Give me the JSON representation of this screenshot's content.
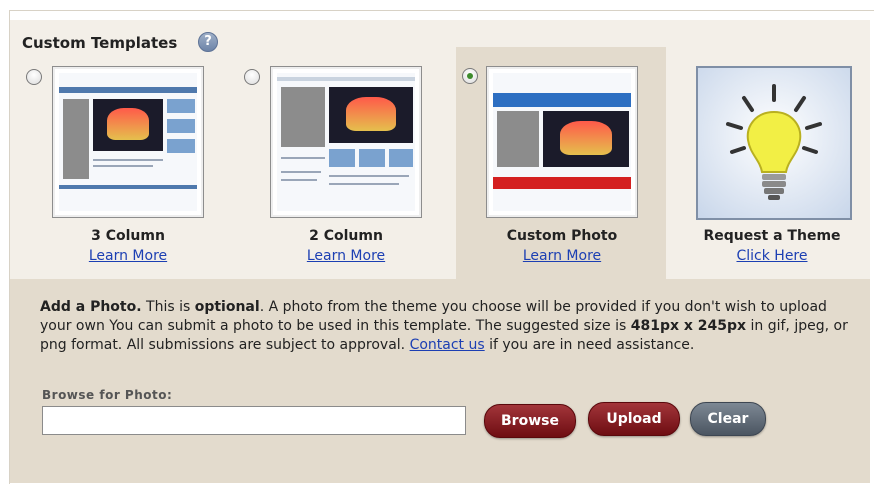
{
  "title": "Custom Templates",
  "help_icon": "?",
  "templates": [
    {
      "title": "3 Column",
      "link": "Learn More",
      "selected": false
    },
    {
      "title": "2 Column",
      "link": "Learn More",
      "selected": false
    },
    {
      "title": "Custom Photo",
      "link": "Learn More",
      "selected": true
    },
    {
      "title": "Request a Theme",
      "link": "Click Here",
      "icon": "lightbulb-icon"
    }
  ],
  "photo_section": {
    "heading": "Add a Photo.",
    "text1": " This is ",
    "optional": "optional",
    "text2": ". A photo from the theme you choose will be provided if you don't wish to upload your own You can submit a photo to be used in this template. The suggested size is ",
    "size": "481px x 245px",
    "text3": " in gif, jpeg, or png format. All submissions are subject to approval. ",
    "contact_link": "Contact us",
    "text4": " if you are in need assistance.",
    "field_label": "Browse for Photo:",
    "input_value": "",
    "browse_label": "Browse",
    "upload_label": "Upload",
    "clear_label": "Clear"
  },
  "colors": {
    "panel": "#f3efe8",
    "selected_panel": "#e3dbcd",
    "link": "#1c3fb3",
    "button_red": "#7a1318",
    "button_gray": "#56606b"
  }
}
